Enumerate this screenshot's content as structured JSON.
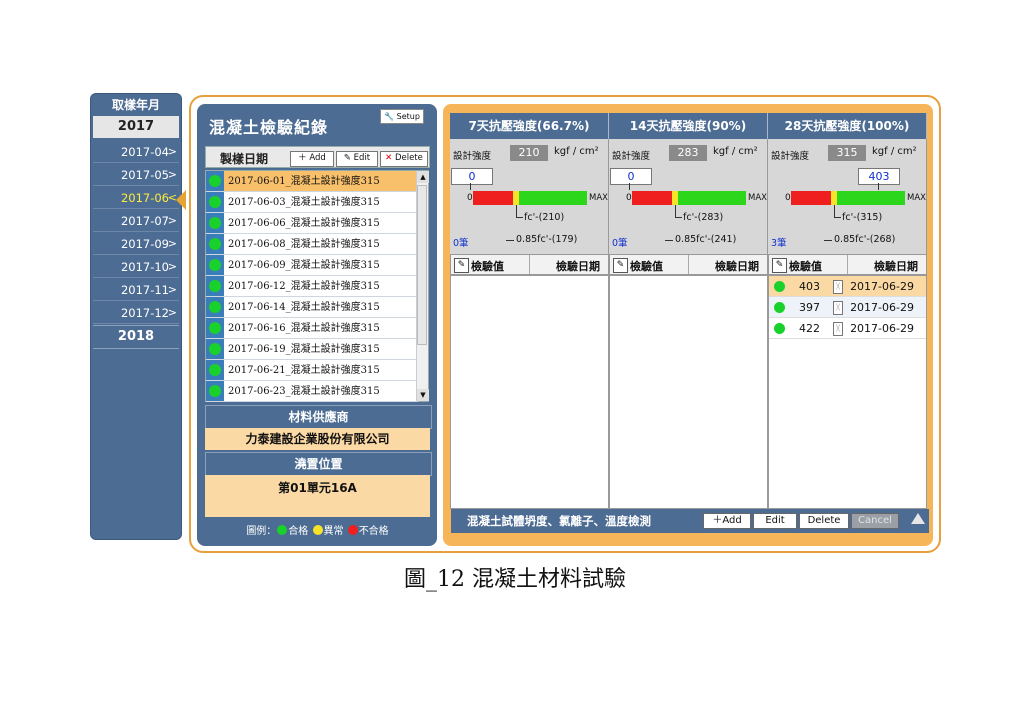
{
  "sidebar": {
    "title": "取樣年月",
    "years": [
      "2017",
      "2018"
    ],
    "months": [
      "2017-04",
      "2017-05",
      "2017-06",
      "2017-07",
      "2017-09",
      "2017-10",
      "2017-11",
      "2017-12"
    ],
    "selected_month": "2017-06"
  },
  "left_panel": {
    "title": "混凝土檢驗紀錄",
    "setup_label": "Setup",
    "column_label": "製樣日期",
    "add_label": "Add",
    "edit_label": "Edit",
    "delete_label": "Delete",
    "records": [
      "2017-06-01_混凝土設計強度315",
      "2017-06-03_混凝土設計強度315",
      "2017-06-06_混凝土設計強度315",
      "2017-06-08_混凝土設計強度315",
      "2017-06-09_混凝土設計強度315",
      "2017-06-12_混凝土設計強度315",
      "2017-06-14_混凝土設計強度315",
      "2017-06-16_混凝土設計強度315",
      "2017-06-19_混凝土設計強度315",
      "2017-06-21_混凝土設計強度315",
      "2017-06-23_混凝土設計強度315"
    ],
    "selected_record_index": 0,
    "supplier_header": "材料供應商",
    "supplier": "力泰建設企業股份有限公司",
    "location_header": "澆置位置",
    "location": "第01單元16A",
    "legend_prefix": "圖例：",
    "legend_pass": "合格",
    "legend_abnormal": "異常",
    "legend_fail": "不合格"
  },
  "columns": [
    {
      "title": "7天抗壓強度(66.7%)",
      "design_label": "設計強度",
      "design_strength": "210",
      "unit": "kgf / cm²",
      "current_value": "0",
      "bar_zero": "0",
      "bar_max": "MAX",
      "fc_label": "fc'-(210)",
      "count": "0筆",
      "f85_label": "0.85fc'-(179)",
      "th_value": "檢驗值",
      "th_date": "檢驗日期",
      "rows": []
    },
    {
      "title": "14天抗壓強度(90%)",
      "design_label": "設計強度",
      "design_strength": "283",
      "unit": "kgf / cm²",
      "current_value": "0",
      "bar_zero": "0",
      "bar_max": "MAX",
      "fc_label": "fc'-(283)",
      "count": "0筆",
      "f85_label": "0.85fc'-(241)",
      "th_value": "檢驗值",
      "th_date": "檢驗日期",
      "rows": []
    },
    {
      "title": "28天抗壓強度(100%)",
      "design_label": "設計強度",
      "design_strength": "315",
      "unit": "kgf / cm²",
      "current_value": "403",
      "bar_zero": "0",
      "bar_max": "MAX",
      "fc_label": "fc'-(315)",
      "count": "3筆",
      "f85_label": "0.85fc'-(268)",
      "th_value": "檢驗值",
      "th_date": "檢驗日期",
      "rows": [
        {
          "value": "403",
          "date": "2017-06-29"
        },
        {
          "value": "397",
          "date": "2017-06-29"
        },
        {
          "value": "422",
          "date": "2017-06-29"
        }
      ]
    }
  ],
  "bottom_bar": {
    "label": "混凝土試體坍度、氯離子、溫度檢測",
    "add_label": "Add",
    "edit_label": "Edit",
    "delete_label": "Delete",
    "cancel_label": "Cancel"
  },
  "caption": "圖_12 混凝土材料試驗",
  "colors": {
    "panel_blue": "#4d6c93",
    "frame_orange": "#e8a03c",
    "pass_green": "#18d12a",
    "abnormal_yellow": "#f7e42a",
    "fail_red": "#f01f1f"
  }
}
